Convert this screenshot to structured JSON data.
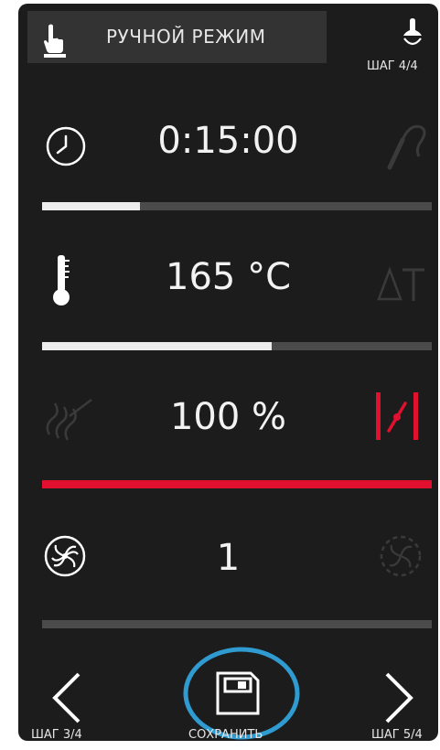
{
  "header": {
    "mode_label": "РУЧНОЙ РЕЖИМ",
    "step_indicator": "ШАГ 4/4"
  },
  "rows": [
    {
      "name": "time",
      "value": "0:15:00",
      "left_icon": "clock-icon",
      "right_icon": "core-probe-icon",
      "progress": 0.25,
      "bar_color": "#ececec"
    },
    {
      "name": "temperature",
      "value": "165 °C",
      "left_icon": "thermometer-icon",
      "right_icon": "delta-t-icon",
      "progress": 0.59,
      "bar_color": "#ececec"
    },
    {
      "name": "humidity",
      "value": "100 %",
      "left_icon": "steam-icon",
      "right_icon": "damper-icon",
      "progress": 1.0,
      "bar_color": "#e0102e"
    },
    {
      "name": "fan",
      "value": "1",
      "left_icon": "fan-speed-icon",
      "right_icon": "fan-pulse-icon",
      "progress": 0.0,
      "bar_color": "#ececec"
    }
  ],
  "footer": {
    "prev_label": "ШАГ 3/4",
    "save_label": "СОХРАНИТЬ",
    "next_label": "ШАГ 5/4"
  },
  "colors": {
    "background": "#1c1c1c",
    "accent_red": "#e0102e",
    "highlight_ring": "#2f9bd0"
  }
}
